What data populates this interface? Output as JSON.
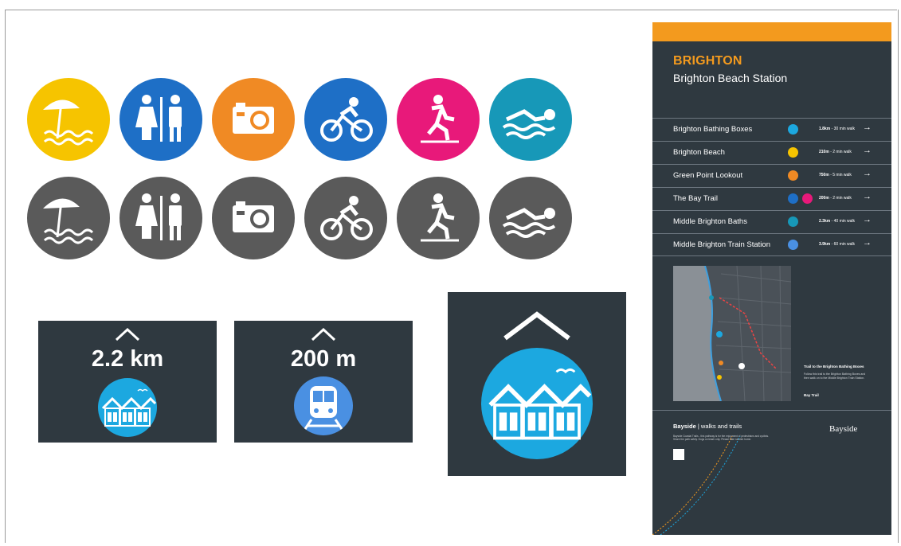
{
  "panel": {
    "title": "BRIGHTON",
    "subtitle": "Brighton Beach Station",
    "destinations": [
      {
        "name": "Brighton Bathing Boxes",
        "distance": "1.8km",
        "time": "- 30 min walk",
        "icon": "bathing-boxes-icon",
        "color": "#1ca8e0"
      },
      {
        "name": "Brighton Beach",
        "distance": "210m",
        "time": "- 2 min walk",
        "icon": "beach-icon",
        "color": "#f6c400"
      },
      {
        "name": "Green Point Lookout",
        "distance": "750m",
        "time": "- 5 min walk",
        "icon": "camera-icon",
        "color": "#f08a24"
      },
      {
        "name": "The Bay Trail",
        "distance": "200m",
        "time": "- 2 min walk",
        "icon": "cycle-walk-icon",
        "color": "#1e6fc6"
      },
      {
        "name": "Middle Brighton Baths",
        "distance": "2.3km",
        "time": "- 40 min walk",
        "icon": "swim-icon",
        "color": "#1798b8"
      },
      {
        "name": "Middle Brighton Train Station",
        "distance": "3.9km",
        "time": "- 60 min walk",
        "icon": "train-icon",
        "color": "#4a90e2"
      }
    ],
    "arrow": "→",
    "legend_trail": "Trail to the Brighton Bathing Boxes",
    "legend_desc": "Follow this trail to the Brighton Bathing Boxes and then walk on to the Middle Brighton Train Station.",
    "legend_bay": "Bay Trail",
    "brand_bold": "Bayside",
    "brand_rest": "walks and trails",
    "logo": "Bayside",
    "small_print": "Bayside Coastal Trails - this pathway is for the enjoyment of pedestrians and cyclists. Share the path safely. Dogs on leash only. Please take rubbish home."
  },
  "signs": {
    "distance_1": "2.2 km",
    "distance_2": "200 m",
    "caret": "^"
  },
  "colors": {
    "yellow": "#f6c400",
    "blue": "#1e6fc6",
    "orange": "#f08a24",
    "magenta": "#e8197a",
    "teal": "#1798b8",
    "grey": "#5a5a5a",
    "sign_bg": "#2f3940",
    "sky": "#1ca8e0",
    "train_blue": "#4a90e2",
    "accent": "#f39a1e"
  },
  "icons_row_color": [
    "beach-icon",
    "toilets-icon",
    "camera-icon",
    "cycling-icon",
    "walking-icon",
    "swimming-icon"
  ],
  "icons_row_grey": [
    "beach-icon",
    "toilets-icon",
    "camera-icon",
    "cycling-icon",
    "walking-icon",
    "swimming-icon"
  ]
}
